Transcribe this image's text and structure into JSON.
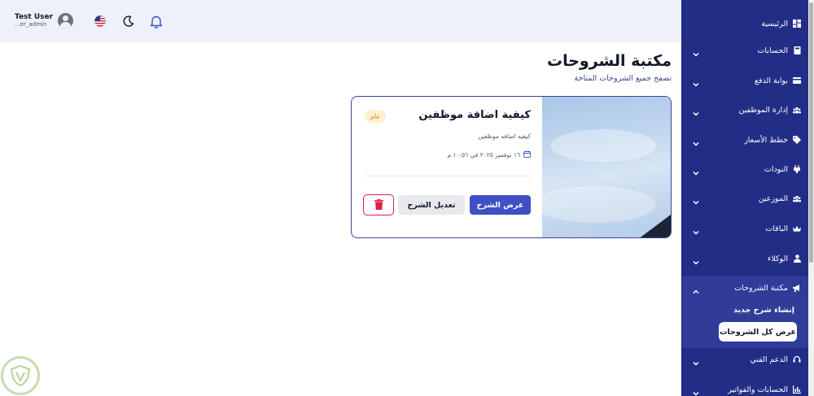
{
  "header": {
    "user_name": "Test User",
    "user_role": "...er_admin",
    "flag_icon": "us-flag-icon",
    "theme_icon": "moon-icon",
    "notifications_icon": "bell-icon"
  },
  "sidebar": {
    "items": [
      {
        "label": "الرئيسية",
        "icon": "dashboard-icon",
        "has_chevron": false
      },
      {
        "label": "الحسابات",
        "icon": "calculator-icon",
        "has_chevron": true
      },
      {
        "label": "بوابة الدفع",
        "icon": "credit-card-icon",
        "has_chevron": true
      },
      {
        "label": "إدارة الموظفين",
        "icon": "users-icon",
        "has_chevron": true
      },
      {
        "label": "خطط الأسعار",
        "icon": "tag-icon",
        "has_chevron": true
      },
      {
        "label": "النودات",
        "icon": "plug-icon",
        "has_chevron": true
      },
      {
        "label": "الموزعين",
        "icon": "people-icon",
        "has_chevron": true
      },
      {
        "label": "الباقات",
        "icon": "crown-icon",
        "has_chevron": true
      },
      {
        "label": "الوكلاء",
        "icon": "agent-icon",
        "has_chevron": true
      },
      {
        "label": "مكتبة الشروحات",
        "icon": "megaphone-icon",
        "has_chevron": true
      },
      {
        "label": "الدعم الفني",
        "icon": "headset-icon",
        "has_chevron": true
      },
      {
        "label": "الحسابات والفواتير",
        "icon": "chart-icon",
        "has_chevron": true
      }
    ],
    "submenu": {
      "create_label": "إنشاء شرح جديد",
      "view_all_label": "عرض كل الشروحات"
    }
  },
  "page": {
    "title": "مكتبة الشروحات",
    "subtitle": "تصفح جميع الشروحات المتاحة"
  },
  "card": {
    "title": "كيفية اضافة موظفين",
    "badge": "عام",
    "description": "كيفيه اضافه موظفين",
    "date": "١٦ نوفمبر ٢٠٢٥ في ١٠:٥٦ م",
    "view_label": "عرض الشرح",
    "edit_label": "تعديل الشرح",
    "delete_icon": "trash-icon"
  },
  "colors": {
    "sidebar_bg": "#222e86",
    "accent": "#3f4fc4",
    "danger": "#e11d48",
    "header_bg": "#eef1fb"
  }
}
